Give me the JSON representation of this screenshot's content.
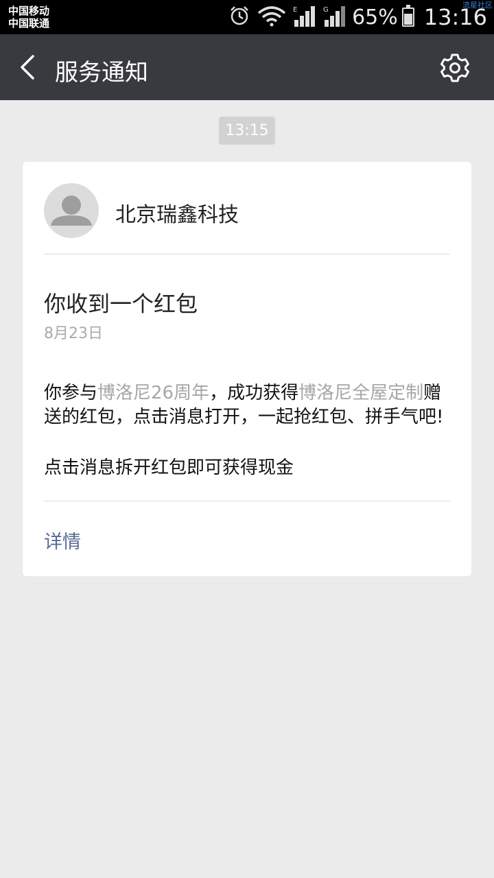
{
  "status_bar": {
    "carrier_1": "中国移动",
    "carrier_2": "中国联通",
    "network_1": "E",
    "network_2": "G",
    "battery_percent": "65%",
    "time": "13:16",
    "watermark": "流星社区",
    "icons": [
      "alarm-icon",
      "wifi-icon",
      "signal-icon",
      "signal-icon",
      "battery-icon"
    ]
  },
  "header": {
    "title": "服务通知",
    "back_icon": "chevron-left-icon",
    "settings_icon": "gear-icon",
    "background": "#393a3f"
  },
  "timestamp": "13:15",
  "card": {
    "sender": "北京瑞鑫科技",
    "title": "你收到一个红包",
    "date": "8月23日",
    "body": {
      "part1": "你参与",
      "highlight1": "博洛尼26周年",
      "part2": "，成功获得",
      "highlight2": "博洛尼全屋定制",
      "part3": "赠送的红包，点击消息打开，一起抢红包、拼手气吧!"
    },
    "note": "点击消息拆开红包即可获得现金",
    "detail_link": "详情",
    "link_color": "#576b95"
  }
}
